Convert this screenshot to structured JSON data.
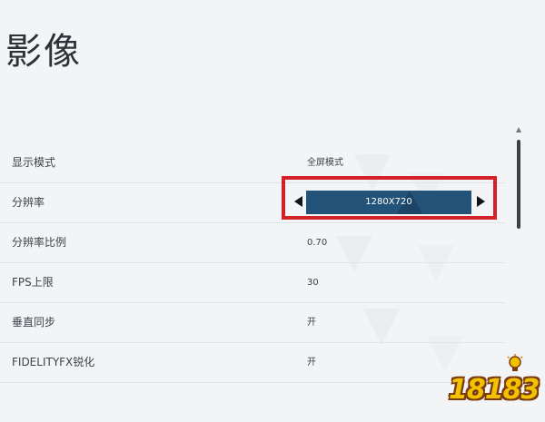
{
  "page": {
    "title": "影像"
  },
  "settings": [
    {
      "label": "显示模式",
      "value": "全屏模式"
    },
    {
      "label": "分辨率",
      "value": "1280X720"
    },
    {
      "label": "分辨率比例",
      "value": "0.70"
    },
    {
      "label": "FPS上限",
      "value": "30"
    },
    {
      "label": "垂直同步",
      "value": "开"
    },
    {
      "label": "FIDELITYFX锐化",
      "value": "开"
    }
  ],
  "watermark": {
    "text": "18183"
  },
  "colors": {
    "selector_fill": "#24537a",
    "highlight_border": "#d42028",
    "background": "#f3f4f5"
  },
  "icons": {
    "left": "arrow-left-icon",
    "right": "arrow-right-icon",
    "scroll_up": "scroll-up-icon"
  }
}
